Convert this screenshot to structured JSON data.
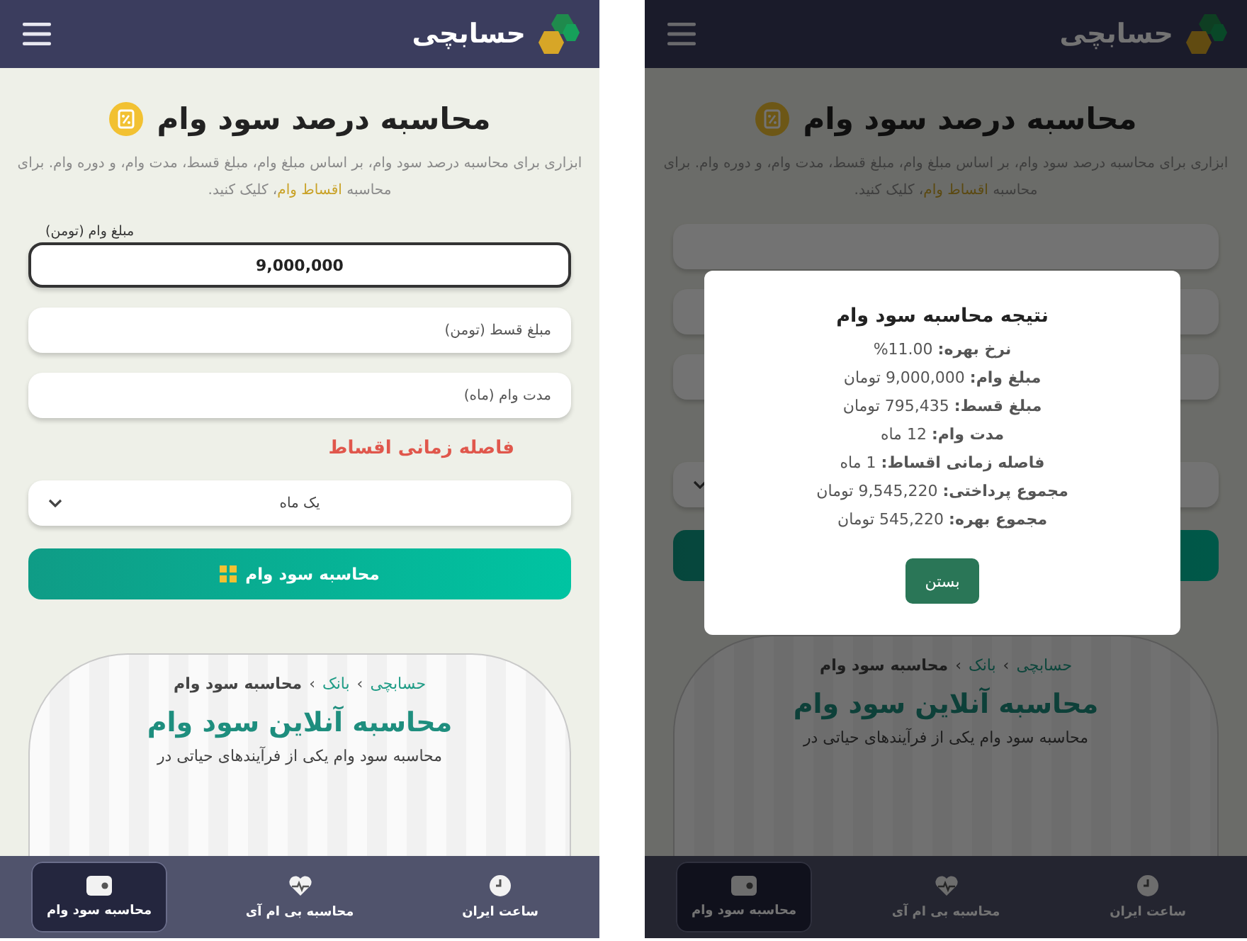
{
  "left_phone": {
    "header": {
      "logo_text": "حسابچی"
    },
    "title": "محاسبه درصد سود وام",
    "description": {
      "before": "ابزاری برای محاسبه درصد سود وام، بر اساس مبلغ وام، مبلغ قسط، مدت وام، و دوره وام. برای محاسبه ",
      "link": "اقساط وام",
      "after": "، کلیک کنید."
    },
    "fields": [
      {
        "kind": "input",
        "label": "مبلغ وام (تومن)",
        "value": "9,000,000",
        "focused": true
      },
      {
        "kind": "input",
        "placeholder": "مبلغ قسط (تومن)",
        "focused": false
      },
      {
        "kind": "input",
        "placeholder": "مدت وام (ماه)",
        "focused": false
      },
      {
        "kind": "heading",
        "label": "فاصله زمانی اقساط"
      },
      {
        "kind": "select",
        "value": "یک ماه"
      }
    ],
    "submit": "محاسبه سود وام",
    "breadcrumb": [
      {
        "label": "حسابچی",
        "kind": "link"
      },
      {
        "label": "›",
        "kind": "sep"
      },
      {
        "label": "بانک",
        "kind": "link"
      },
      {
        "label": "›",
        "kind": "sep"
      },
      {
        "label": "محاسبه سود وام",
        "kind": "current"
      }
    ],
    "article_heading": "محاسبه آنلاین سود وام",
    "article_text": "محاسبه سود وام یکی از فرآیندهای حیاتی در",
    "nav": [
      {
        "label": "ساعت ایران",
        "kind": "clock",
        "selected": false
      },
      {
        "label": "محاسبه بی ام آی",
        "kind": "heart",
        "selected": false
      },
      {
        "label": "محاسبه سود وام",
        "kind": "wallet",
        "selected": true
      }
    ]
  },
  "right_phone": {
    "header": {
      "logo_text": "حسابچی"
    },
    "title": "محاسبه درصد سود وام",
    "description": {
      "before": "ابزاری برای محاسبه درصد سود وام، بر اساس مبلغ وام، مبلغ قسط، مدت وام، و دوره وام. برای محاسبه ",
      "link": "اقساط وام",
      "after": "، کلیک کنید."
    },
    "fields": [
      {
        "kind": "input"
      },
      {
        "kind": "input"
      },
      {
        "kind": "input"
      },
      {
        "kind": "heading"
      },
      {
        "kind": "select"
      }
    ],
    "breadcrumb": [
      {
        "label": "حسابچی",
        "kind": "link"
      },
      {
        "label": "›",
        "kind": "sep"
      },
      {
        "label": "بانک",
        "kind": "link"
      },
      {
        "label": "›",
        "kind": "sep"
      },
      {
        "label": "محاسبه سود وام",
        "kind": "current"
      }
    ],
    "article_heading": "محاسبه آنلاین سود وام",
    "article_text": "محاسبه سود وام یکی از فرآیندهای حیاتی در",
    "nav": [
      {
        "label": "ساعت ایران",
        "kind": "clock",
        "selected": false
      },
      {
        "label": "محاسبه بی ام آی",
        "kind": "heart",
        "selected": false
      },
      {
        "label": "محاسبه سود وام",
        "kind": "wallet",
        "selected": true
      }
    ],
    "dialog": {
      "title": "نتیجه محاسبه سود وام",
      "lines": [
        "**نرخ بهره:** 11.00%",
        "**مبلغ وام:** 9,000,000 تومان",
        "**مبلغ قسط:** 795,435 تومان",
        "**مدت وام:** 12 ماه",
        "**فاصله زمانی اقساط:** 1 ماه",
        "**مجموع پرداختی:** 9,545,220 تومان",
        "**مجموع بهره:** 545,220 تومان"
      ],
      "button": "بستن"
    }
  }
}
